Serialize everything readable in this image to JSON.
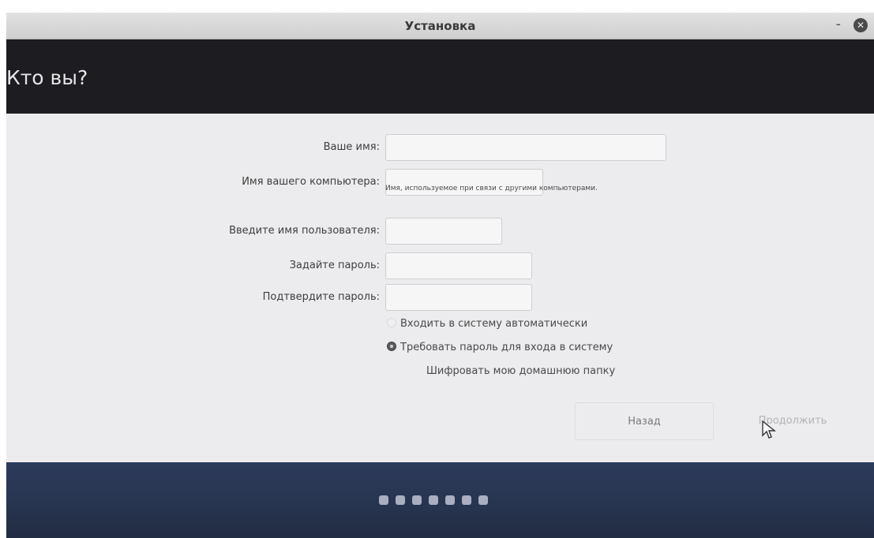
{
  "window": {
    "title": "Установка",
    "minimize_label": "-",
    "close_label": "✕"
  },
  "header": {
    "title": "Кто вы?"
  },
  "form": {
    "name_label": "Ваше имя:",
    "computer_label": "Имя вашего компьютера:",
    "computer_hint": "Имя, используемое при связи с другими компьютерами.",
    "username_label": "Введите имя пользователя:",
    "password_label": "Задайте пароль:",
    "confirm_label": "Подтвердите пароль:",
    "name_value": "",
    "computer_value": "",
    "username_value": "",
    "password_value": "",
    "confirm_value": ""
  },
  "options": {
    "auto_login": "Входить в систему автоматически",
    "require_password": "Требовать пароль для входа в систему",
    "encrypt_home": "Шифровать мою домашнюю папку",
    "selected": "require_password"
  },
  "buttons": {
    "back": "Назад",
    "continue": "Продолжить"
  },
  "progress": {
    "steps": 7
  },
  "colors": {
    "header_bg": "#1d1c20",
    "footer_bg": "#27344f",
    "content_bg": "#ecebed"
  },
  "icons": {
    "close": "close-icon",
    "minimize": "minimize-icon",
    "cursor": "mouse-pointer-icon"
  }
}
